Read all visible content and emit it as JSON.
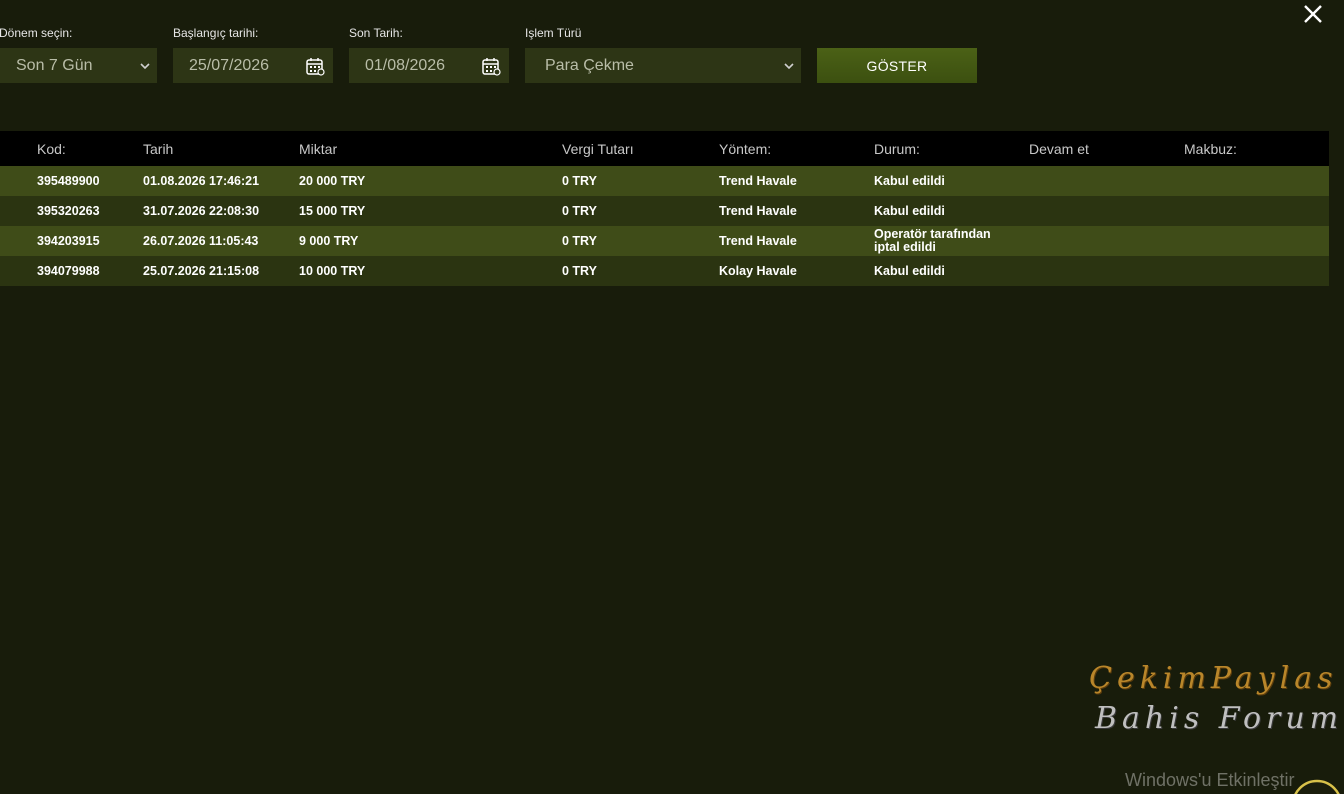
{
  "filters": {
    "period": {
      "label": "Dönem seçin:",
      "value": "Son 7 Gün"
    },
    "start_date": {
      "label": "Başlangıç tarihi:",
      "value": "25/07/2026"
    },
    "end_date": {
      "label": "Son Tarih:",
      "value": "01/08/2026"
    },
    "transaction_type": {
      "label": "Işlem Türü",
      "value": "Para Çekme"
    },
    "show_button": "GÖSTER"
  },
  "table": {
    "columns": {
      "code": "Kod:",
      "date": "Tarih",
      "amount": "Miktar",
      "tax": "Vergi Tutarı",
      "method": "Yöntem:",
      "status": "Durum:",
      "continue": "Devam et",
      "receipt": "Makbuz:"
    },
    "rows": [
      {
        "code": "395489900",
        "date": "01.08.2026 17:46:21",
        "amount": "20 000 TRY",
        "tax": "0 TRY",
        "method": "Trend Havale",
        "status": [
          "Kabul edildi"
        ]
      },
      {
        "code": "395320263",
        "date": "31.07.2026 22:08:30",
        "amount": "15 000 TRY",
        "tax": "0 TRY",
        "method": "Trend Havale",
        "status": [
          "Kabul edildi"
        ]
      },
      {
        "code": "394203915",
        "date": "26.07.2026 11:05:43",
        "amount": "9 000 TRY",
        "tax": "0 TRY",
        "method": "Trend Havale",
        "status": [
          "Operatör tarafından",
          "iptal edildi"
        ]
      },
      {
        "code": "394079988",
        "date": "25.07.2026 21:15:08",
        "amount": "10 000 TRY",
        "tax": "0 TRY",
        "method": "Kolay Havale",
        "status": [
          "Kabul edildi"
        ]
      }
    ]
  },
  "watermark": {
    "line1": "ÇekimPaylas",
    "line2": "Bahis Forum"
  },
  "system_overlay": "Windows'u Etkinleştir",
  "colors": {
    "background": "#181c0b",
    "row_odd": "#3f4c18",
    "row_even": "#2b3411",
    "header": "#000000",
    "accent_button": "#4b6116"
  }
}
